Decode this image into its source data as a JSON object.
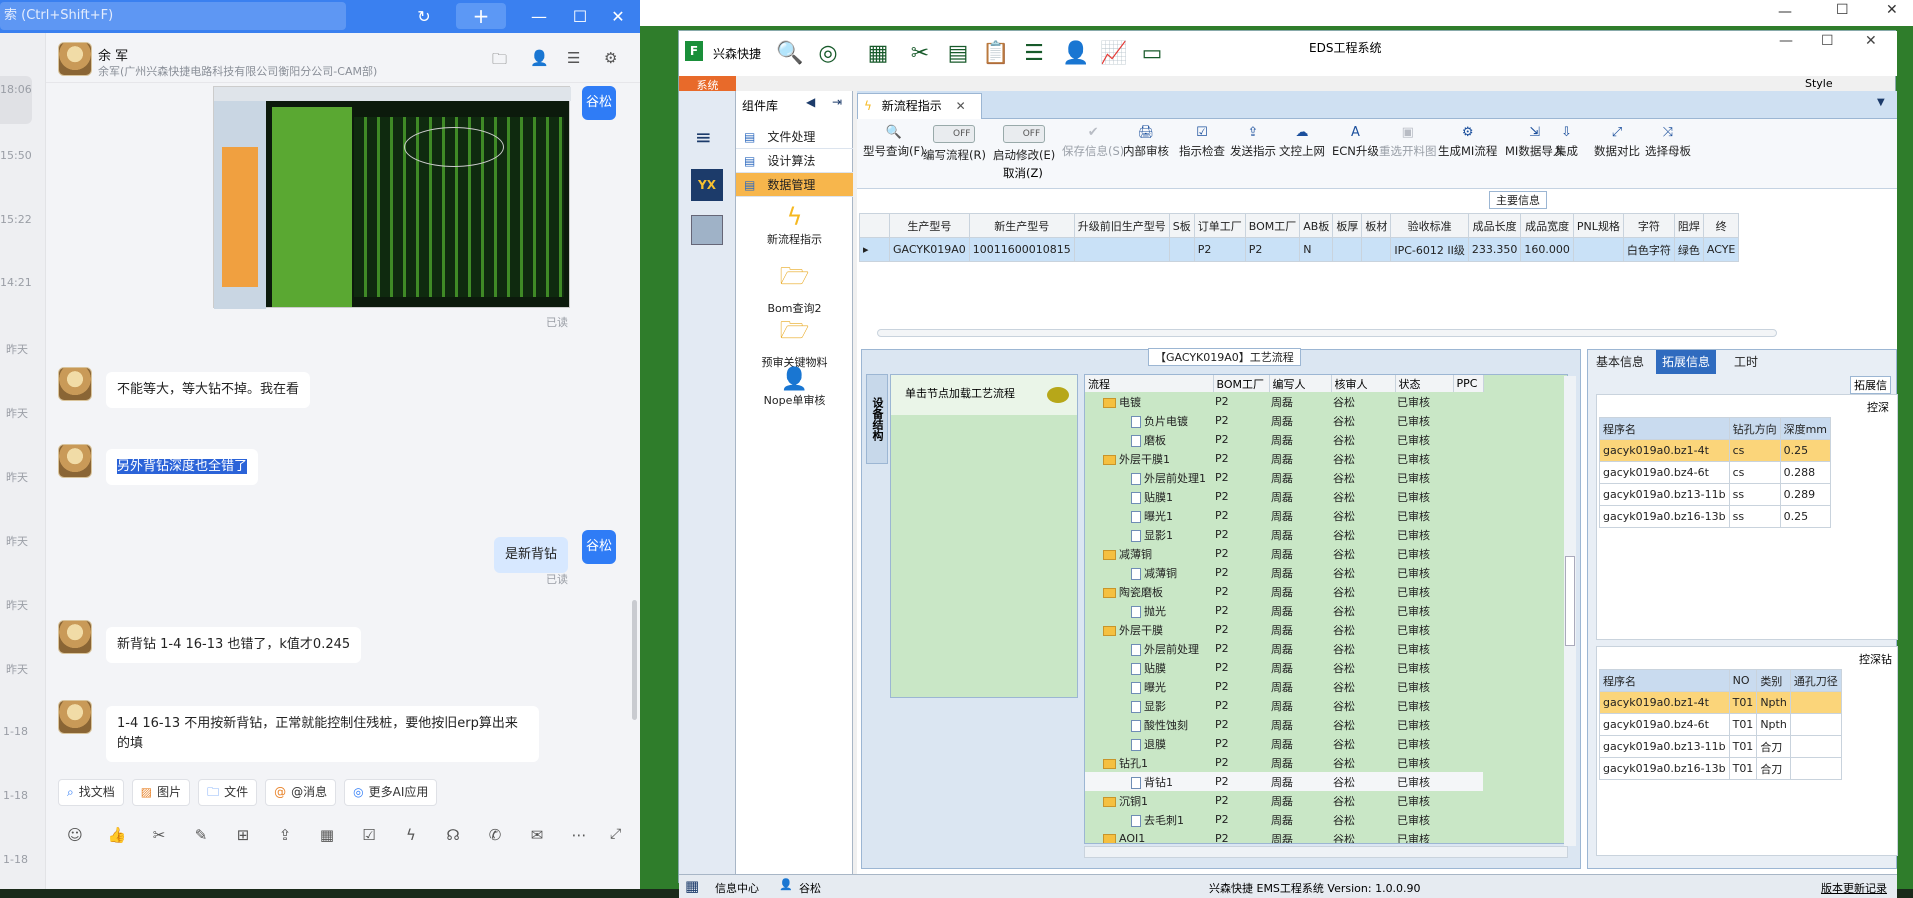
{
  "chat": {
    "search_placeholder": "索 (Ctrl+Shift+F)",
    "timestamps": [
      "18:06",
      "15:50",
      "15:22",
      "14:21",
      "昨天",
      "昨天",
      "昨天",
      "昨天",
      "昨天",
      "昨天",
      "1-18",
      "1-18",
      "1-18"
    ],
    "contact_name": "余 军",
    "contact_org": "余军(广州兴森快捷电路科技有限公司衡阳分公司-CAM部)",
    "my_name": "谷松",
    "read_label": "已读",
    "messages": [
      "不能等大，等大钻不掉。我在看",
      "另外背钻深度也全错了",
      "是新背钻",
      "新背钻 1-4 16-13 也错了，k值才0.245",
      "1-4 16-13 不用按新背钻，正常就能控制住残桩，要他按旧erp算出来的填"
    ],
    "quick_actions": [
      "找文档",
      "图片",
      "文件",
      "@消息",
      "更多AI应用"
    ]
  },
  "eds": {
    "title": "EDS工程系统",
    "brand": "兴森快捷",
    "style_label": "Style",
    "menu_tab": "系统",
    "component_lib": "组件库",
    "comp_items": [
      "文件处理",
      "设计算法",
      "数据管理"
    ],
    "icon_items": [
      "新流程指示",
      "Bom查询2",
      "预审关键物料",
      "Nope单审核"
    ],
    "active_tab": "新流程指示",
    "ribbon": [
      {
        "label": "型号查询(F)",
        "ic": "🔍"
      },
      {
        "label": "编写流程(R)",
        "ic": "OFF"
      },
      {
        "label": "启动修改(E)",
        "ic": "OFF"
      },
      {
        "label": "保存信息(S)",
        "ic": "✔"
      },
      {
        "label": "内部审核",
        "ic": "🖨"
      },
      {
        "label": "指示检查",
        "ic": "☑"
      },
      {
        "label": "发送指示",
        "ic": "⇪"
      },
      {
        "label": "文控上网",
        "ic": "☁"
      },
      {
        "label": "ECN升级",
        "ic": "A"
      },
      {
        "label": "重选开料图",
        "ic": "▣"
      },
      {
        "label": "生成MI流程",
        "ic": "⚙"
      },
      {
        "label": "MI数据导入",
        "ic": "⇲"
      },
      {
        "label": "集成",
        "ic": "⇩"
      },
      {
        "label": "数据对比",
        "ic": "⤢"
      },
      {
        "label": "选择母板",
        "ic": "⤨"
      }
    ],
    "cancel_label": "取消(Z)",
    "main_info": "主要信息",
    "grid_headers": [
      "生产型号",
      "新生产型号",
      "升级前旧生产型号",
      "S板",
      "订单工厂",
      "BOM工厂",
      "AB板",
      "板厚",
      "板材",
      "验收标准",
      "成品长度",
      "成品宽度",
      "PNL规格",
      "字符",
      "阻焊",
      "终"
    ],
    "grid_row": [
      "GACYK019A0",
      "10011600010815",
      "",
      "",
      "P2",
      "P2",
      "N",
      "",
      "",
      "IPC-6012 II级",
      "233.350",
      "160.000",
      "",
      "白色字符",
      "绿色",
      "ACYE"
    ],
    "flow_title": "【GACYK019A0】工艺流程",
    "equip_label": "设备结构",
    "node_hint": "单击节点加载工艺流程",
    "tree_headers": [
      "流程",
      "BOM工厂",
      "编写人",
      "核审人",
      "状态",
      "PPC"
    ],
    "tree_rows": [
      {
        "name": "电镀",
        "lv": 1,
        "f": 1
      },
      {
        "name": "负片电镀",
        "lv": 2,
        "f": 0
      },
      {
        "name": "磨板",
        "lv": 2,
        "f": 0
      },
      {
        "name": "外层干膜1",
        "lv": 1,
        "f": 1
      },
      {
        "name": "外层前处理1",
        "lv": 2,
        "f": 0
      },
      {
        "name": "贴膜1",
        "lv": 2,
        "f": 0
      },
      {
        "name": "曝光1",
        "lv": 2,
        "f": 0
      },
      {
        "name": "显影1",
        "lv": 2,
        "f": 0
      },
      {
        "name": "减薄铜",
        "lv": 1,
        "f": 1
      },
      {
        "name": "减薄铜",
        "lv": 2,
        "f": 0
      },
      {
        "name": "陶瓷磨板",
        "lv": 1,
        "f": 1
      },
      {
        "name": "抛光",
        "lv": 2,
        "f": 0
      },
      {
        "name": "外层干膜",
        "lv": 1,
        "f": 1
      },
      {
        "name": "外层前处理",
        "lv": 2,
        "f": 0
      },
      {
        "name": "贴膜",
        "lv": 2,
        "f": 0
      },
      {
        "name": "曝光",
        "lv": 2,
        "f": 0
      },
      {
        "name": "显影",
        "lv": 2,
        "f": 0
      },
      {
        "name": "酸性蚀刻",
        "lv": 2,
        "f": 0
      },
      {
        "name": "退膜",
        "lv": 2,
        "f": 0
      },
      {
        "name": "钻孔1",
        "lv": 1,
        "f": 1
      },
      {
        "name": "背钻1",
        "lv": 2,
        "f": 0
      },
      {
        "name": "沉铜1",
        "lv": 1,
        "f": 1
      },
      {
        "name": "去毛刺1",
        "lv": 2,
        "f": 0
      },
      {
        "name": "AOI1",
        "lv": 1,
        "f": 1
      }
    ],
    "tree_factory": "P2",
    "tree_writer": "周磊",
    "tree_checker": "谷松",
    "tree_status": "已审核",
    "right_tabs": [
      "基本信息",
      "拓展信息",
      "工时"
    ],
    "ext_label": "拓展信",
    "ctrl_depth_label": "控深",
    "ctrl_drill_label": "控深钻",
    "depth_headers": [
      "程序名",
      "钻孔方向",
      "深度mm"
    ],
    "depth_rows": [
      [
        "gacyk019a0.bz1-4t",
        "cs",
        "0.25"
      ],
      [
        "gacyk019a0.bz4-6t",
        "cs",
        "0.288"
      ],
      [
        "gacyk019a0.bz13-11b",
        "ss",
        "0.289"
      ],
      [
        "gacyk019a0.bz16-13b",
        "ss",
        "0.25"
      ]
    ],
    "drill_headers": [
      "程序名",
      "NO",
      "类别",
      "通孔刀径"
    ],
    "drill_rows": [
      [
        "gacyk019a0.bz1-4t",
        "T01",
        "Npth",
        ""
      ],
      [
        "gacyk019a0.bz4-6t",
        "T01",
        "Npth",
        ""
      ],
      [
        "gacyk019a0.bz13-11b",
        "T01",
        "合刀",
        ""
      ],
      [
        "gacyk019a0.bz16-13b",
        "T01",
        "合刀",
        ""
      ]
    ],
    "status_info_center": "信息中心",
    "status_user": "谷松",
    "status_version": "兴森快捷 EMS工程系统 Version: 1.0.0.90",
    "status_history": "版本更新记录"
  }
}
